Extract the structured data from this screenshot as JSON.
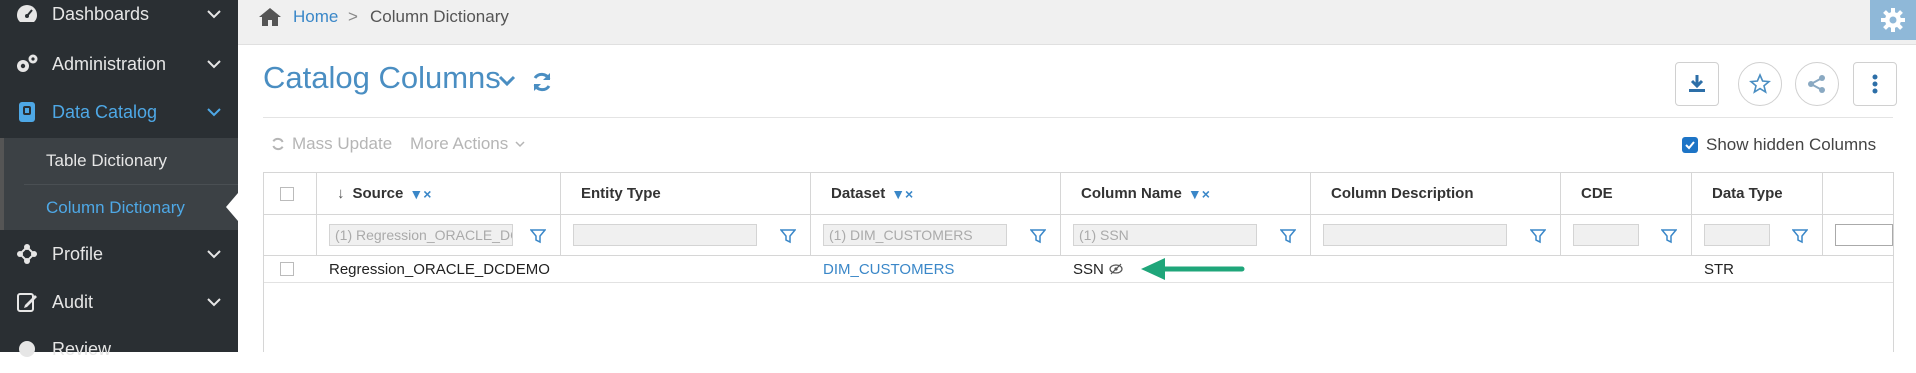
{
  "sidebar": {
    "items": [
      {
        "label": "Dashboards"
      },
      {
        "label": "Administration"
      },
      {
        "label": "Data Catalog"
      },
      {
        "label": "Profile"
      },
      {
        "label": "Audit"
      },
      {
        "label": "Review"
      }
    ],
    "sub_items": [
      {
        "label": "Table Dictionary"
      },
      {
        "label": "Column Dictionary"
      }
    ]
  },
  "breadcrumb": {
    "home": "Home",
    "separator": ">",
    "current": "Column Dictionary"
  },
  "header": {
    "title": "Catalog Columns"
  },
  "actions": {
    "mass_update": "Mass Update",
    "more_actions": "More Actions",
    "show_hidden": "Show hidden Columns"
  },
  "table": {
    "columns": [
      {
        "label": "Source",
        "filter_value": "(1) Regression_ORACLE_DC"
      },
      {
        "label": "Entity Type",
        "filter_value": ""
      },
      {
        "label": "Dataset",
        "filter_value": "(1) DIM_CUSTOMERS"
      },
      {
        "label": "Column Name",
        "filter_value": "(1) SSN"
      },
      {
        "label": "Column Description",
        "filter_value": ""
      },
      {
        "label": "CDE",
        "filter_value": ""
      },
      {
        "label": "Data Type",
        "filter_value": ""
      }
    ],
    "rows": [
      {
        "source": "Regression_ORACLE_DCDEMO",
        "entity_type": "",
        "dataset": "DIM_CUSTOMERS",
        "column_name": "SSN",
        "column_description": "",
        "cde": "",
        "data_type": "STR"
      }
    ]
  },
  "colors": {
    "accent": "#4a8ec2",
    "link": "#3a87c8",
    "sidebar_bg": "#2a2f33",
    "annotation_arrow": "#1fa67a"
  }
}
